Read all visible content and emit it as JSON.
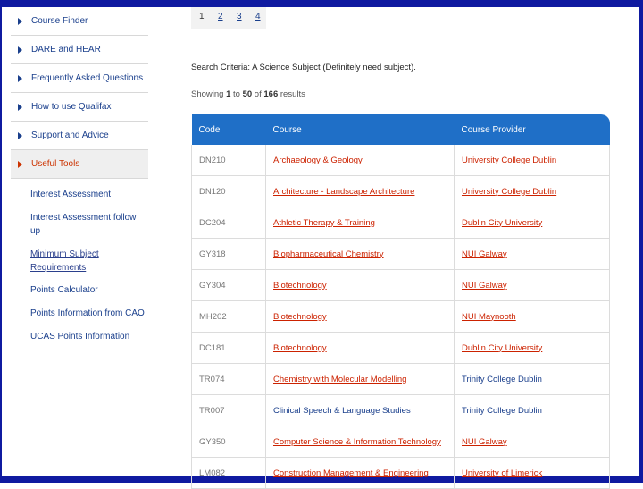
{
  "sidebar": {
    "items": [
      {
        "label": "Course Finder",
        "active": false
      },
      {
        "label": "DARE and HEAR",
        "active": false
      },
      {
        "label": "Frequently Asked Questions",
        "active": false
      },
      {
        "label": "How to use Qualifax",
        "active": false
      },
      {
        "label": "Support and Advice",
        "active": false
      },
      {
        "label": "Useful Tools",
        "active": true
      }
    ],
    "subitems": [
      "Interest Assessment",
      "Interest Assessment follow up",
      "Minimum Subject Requirements",
      "Points Calculator",
      "Points Information from CAO",
      "UCAS Points Information"
    ]
  },
  "pagination": {
    "pages": [
      "1",
      "2",
      "3",
      "4"
    ],
    "current": "1"
  },
  "search": {
    "criteria": "Search Criteria: A Science Subject (Definitely need subject).",
    "showing_prefix": "Showing ",
    "range_start": "1",
    "range_mid": " to ",
    "range_end": "50",
    "of_text": " of ",
    "total": "166",
    "results_suffix": " results"
  },
  "table": {
    "headers": [
      "Code",
      "Course",
      "Course Provider"
    ],
    "rows": [
      {
        "code": "DN210",
        "course": "Archaeology & Geology",
        "provider": "University College Dublin",
        "course_linked": true,
        "provider_linked": true
      },
      {
        "code": "DN120",
        "course": "Architecture - Landscape Architecture",
        "provider": "University College Dublin",
        "course_linked": true,
        "provider_linked": true
      },
      {
        "code": "DC204",
        "course": "Athletic Therapy & Training",
        "provider": "Dublin City University",
        "course_linked": true,
        "provider_linked": true
      },
      {
        "code": "GY318",
        "course": "Biopharmaceutical Chemistry",
        "provider": "NUI Galway",
        "course_linked": true,
        "provider_linked": true
      },
      {
        "code": "GY304",
        "course": "Biotechnology",
        "provider": "NUI Galway",
        "course_linked": true,
        "provider_linked": true
      },
      {
        "code": "MH202",
        "course": "Biotechnology",
        "provider": "NUI Maynooth",
        "course_linked": true,
        "provider_linked": true
      },
      {
        "code": "DC181",
        "course": "Biotechnology",
        "provider": "Dublin City University",
        "course_linked": true,
        "provider_linked": true
      },
      {
        "code": "TR074",
        "course": "Chemistry with Molecular Modelling",
        "provider": "Trinity College Dublin",
        "course_linked": true,
        "provider_linked": false
      },
      {
        "code": "TR007",
        "course": "Clinical Speech & Language Studies",
        "provider": "Trinity College Dublin",
        "course_linked": false,
        "provider_linked": false
      },
      {
        "code": "GY350",
        "course": "Computer Science & Information Technology",
        "provider": "NUI Galway",
        "course_linked": true,
        "provider_linked": true
      },
      {
        "code": "LM082",
        "course": "Construction Management & Engineering",
        "provider": "University of Limerick",
        "course_linked": true,
        "provider_linked": true
      }
    ]
  }
}
